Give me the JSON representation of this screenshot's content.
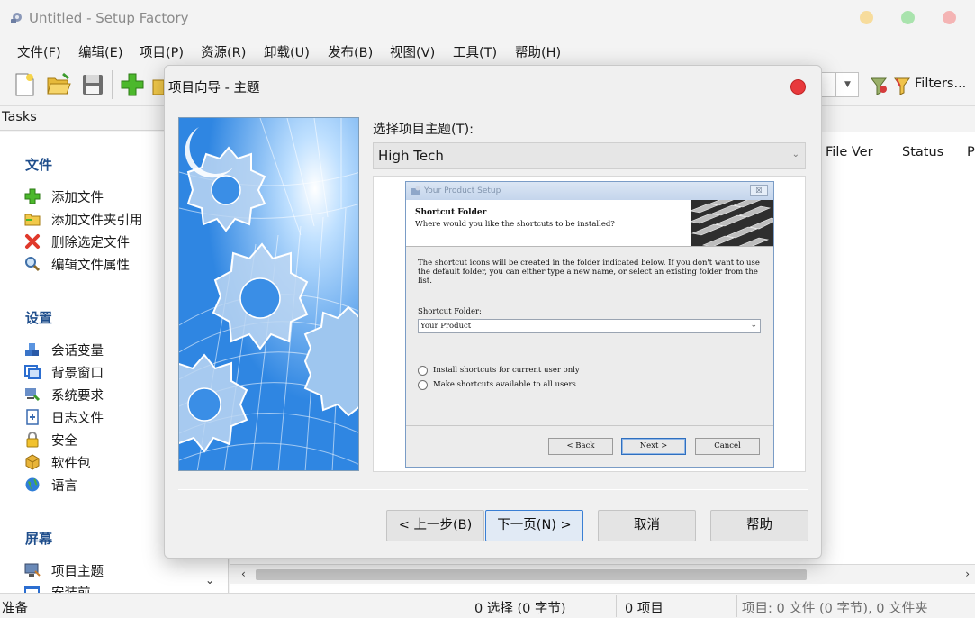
{
  "app": {
    "title": "Untitled - Setup Factory"
  },
  "window_controls": {
    "minimize_color": "#f7dc9c",
    "maximize_color": "#a9e3ad",
    "close_color": "#f4b4b4"
  },
  "menu": {
    "items": [
      {
        "label": "文件(F)"
      },
      {
        "label": "编辑(E)"
      },
      {
        "label": "项目(P)"
      },
      {
        "label": "资源(R)"
      },
      {
        "label": "卸载(U)"
      },
      {
        "label": "发布(B)"
      },
      {
        "label": "视图(V)"
      },
      {
        "label": "工具(T)"
      },
      {
        "label": "帮助(H)"
      }
    ]
  },
  "toolbar": {
    "icons": [
      "new-document-icon",
      "open-folder-icon",
      "save-icon",
      "add-file-icon",
      "folder-icon"
    ],
    "filters_label": "Filters..."
  },
  "tasks": {
    "header": "Tasks",
    "sections": [
      {
        "title": "文件",
        "items": [
          {
            "label": "添加文件",
            "icon": "add-file-icon"
          },
          {
            "label": "添加文件夹引用",
            "icon": "add-folder-reference-icon"
          },
          {
            "label": "删除选定文件",
            "icon": "delete-icon"
          },
          {
            "label": "编辑文件属性",
            "icon": "edit-properties-icon"
          }
        ]
      },
      {
        "title": "设置",
        "items": [
          {
            "label": "会话变量",
            "icon": "session-variables-icon"
          },
          {
            "label": "背景窗口",
            "icon": "background-window-icon"
          },
          {
            "label": "系统要求",
            "icon": "system-requirements-icon"
          },
          {
            "label": "日志文件",
            "icon": "log-file-icon"
          },
          {
            "label": "安全",
            "icon": "lock-icon"
          },
          {
            "label": "软件包",
            "icon": "package-icon"
          },
          {
            "label": "语言",
            "icon": "globe-icon"
          }
        ]
      },
      {
        "title": "屏幕",
        "items": [
          {
            "label": "项目主题",
            "icon": "project-theme-icon"
          },
          {
            "label": "安装前",
            "icon": "before-install-icon"
          }
        ]
      }
    ]
  },
  "file_list": {
    "columns": [
      "File Ver",
      "Status",
      "P"
    ]
  },
  "statusbar": {
    "ready": "准备",
    "selection": "0 选择 (0 字节)",
    "items": "0 项目",
    "project": "项目: 0 文件 (0 字节), 0 文件夹"
  },
  "dialog": {
    "title": "项目向导 - 主题",
    "theme_label": "选择项目主题(T):",
    "theme_value": "High Tech",
    "buttons": {
      "back": "< 上一步(B)",
      "next": "下一页(N) >",
      "cancel": "取消",
      "help": "帮助"
    },
    "preview": {
      "window_title": "Your Product Setup",
      "close": "☒",
      "heading": "Shortcut Folder",
      "subheading": "Where would you like the shortcuts to be installed?",
      "body": "The shortcut icons will be created in the folder indicated below. If you don't want to use the default folder, you can either type a new name, or select an existing folder from the list.",
      "field_label": "Shortcut Folder:",
      "field_value": "Your Product",
      "radio_current_user": "Install shortcuts for current user only",
      "radio_all_users": "Make shortcuts available to all users",
      "btn_back": "< Back",
      "btn_next": "Next >",
      "btn_cancel": "Cancel"
    }
  }
}
